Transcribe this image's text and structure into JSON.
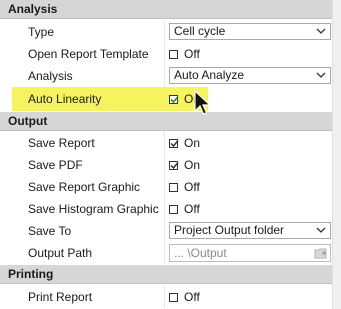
{
  "sections": {
    "analysis": "Analysis",
    "output": "Output",
    "printing": "Printing"
  },
  "analysis": {
    "type": {
      "label": "Type",
      "value": "Cell cycle"
    },
    "open_report_template": {
      "label": "Open Report Template",
      "checked": false,
      "value": "Off"
    },
    "analysis": {
      "label": "Analysis",
      "value": "Auto Analyze"
    },
    "auto_linearity": {
      "label": "Auto Linearity",
      "checked": true,
      "value": "On"
    }
  },
  "output": {
    "save_report": {
      "label": "Save Report",
      "checked": true,
      "value": "On"
    },
    "save_pdf": {
      "label": "Save PDF",
      "checked": true,
      "value": "On"
    },
    "save_report_graphic": {
      "label": "Save Report Graphic",
      "checked": false,
      "value": "Off"
    },
    "save_histogram_graphic": {
      "label": "Save Histogram Graphic",
      "checked": false,
      "value": "Off"
    },
    "save_to": {
      "label": "Save To",
      "value": "Project Output folder"
    },
    "output_path": {
      "label": "Output Path",
      "value": "... \\Output"
    }
  },
  "printing": {
    "print_report": {
      "label": "Print Report",
      "checked": false,
      "value": "Off"
    }
  },
  "colors": {
    "section_header_bg": "#d6d6d6",
    "highlight": "#f6f45e",
    "check_green": "#2e8b2e"
  },
  "icons": {
    "combo_chevron": "chevron-down-icon",
    "checkbox": "checkbox-icon",
    "folder": "folder-icon",
    "cursor": "mouse-pointer-icon"
  }
}
